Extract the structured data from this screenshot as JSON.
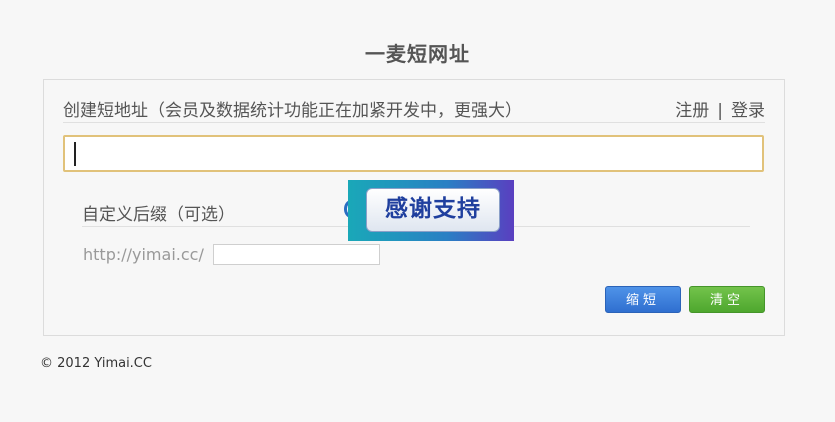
{
  "site": {
    "title": "一麦短网址"
  },
  "panel": {
    "heading": "创建短地址（会员及数据统计功能正在加紧开发中，更强大）",
    "register_link": "注册",
    "separator": "|",
    "login_link": "登录",
    "url_input": {
      "value": "",
      "placeholder": ""
    },
    "suffix_label": "自定义后缀（可选）",
    "prefix_text": "http://yimai.cc/",
    "suffix_input": {
      "value": "",
      "placeholder": ""
    },
    "shorten_button": "缩短",
    "clear_button": "清空"
  },
  "promo": {
    "label": "感谢支持"
  },
  "footer": {
    "copyright": "© 2012 Yimai.CC"
  },
  "colors": {
    "accent_blue": "#2f6fd0",
    "accent_green": "#4ea72e",
    "input_focus_border": "#e1c27a"
  },
  "icons": {
    "help": "help-icon"
  }
}
